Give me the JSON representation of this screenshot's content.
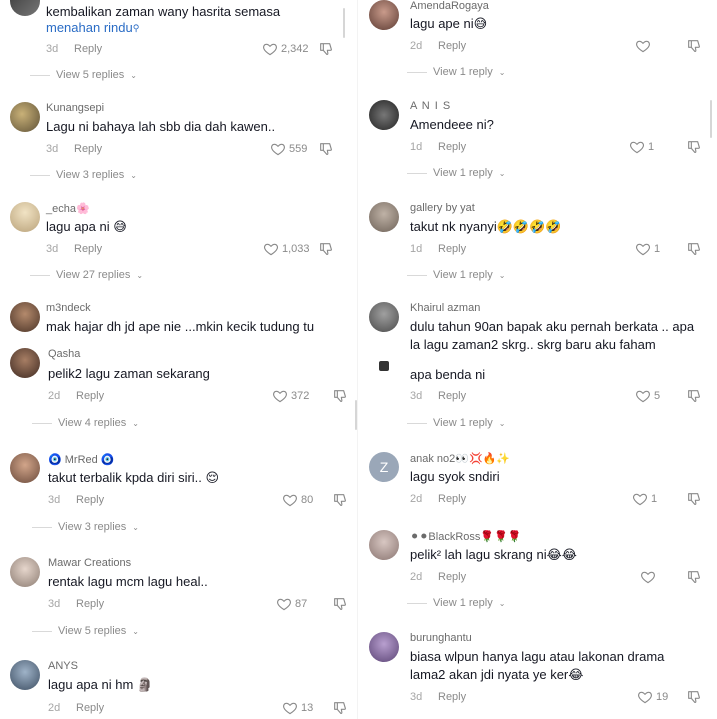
{
  "left": {
    "comments": [
      {
        "username": "",
        "text": "kembalikan zaman wany hasrita semasa",
        "text_extra": "menahan rindu",
        "date": "3d",
        "reply": "Reply",
        "likes": "2,342",
        "view_replies": "View 5 replies"
      },
      {
        "username": "Kunangsepi",
        "text": "Lagu ni bahaya lah sbb dia dah kawen..",
        "date": "3d",
        "reply": "Reply",
        "likes": "559",
        "view_replies": "View 3 replies"
      },
      {
        "username": "_echa🌸",
        "text": "lagu apa ni 😅",
        "date": "3d",
        "reply": "Reply",
        "likes": "1,033",
        "view_replies": "View 27 replies"
      },
      {
        "username": "m3ndeck",
        "text": "mak hajar dh jd ape nie ...mkin kecik tudung tu",
        "date": "",
        "reply": "",
        "likes": "",
        "view_replies": ""
      },
      {
        "username": "Qasha",
        "text": "pelik2 lagu zaman sekarang",
        "date": "2d",
        "reply": "Reply",
        "likes": "372",
        "view_replies": "View 4 replies"
      },
      {
        "username": "🧿 MrRed 🧿",
        "text": "takut terbalik kpda diri siri.. 😌",
        "date": "3d",
        "reply": "Reply",
        "likes": "80",
        "view_replies": "View 3 replies"
      },
      {
        "username": "Mawar Creations",
        "text": "rentak lagu mcm lagu heal..",
        "date": "3d",
        "reply": "Reply",
        "likes": "87",
        "view_replies": "View 5 replies"
      },
      {
        "username": "ANYS",
        "text": "lagu apa ni hm 🗿",
        "date": "2d",
        "reply": "Reply",
        "likes": "13",
        "view_replies": ""
      }
    ]
  },
  "right": {
    "comments": [
      {
        "username": "AmendaRogaya",
        "text": "lagu ape ni😅",
        "date": "2d",
        "reply": "Reply",
        "likes": "",
        "view_replies": "View 1 reply"
      },
      {
        "username": "A N I S",
        "text": "Amendeee ni?",
        "date": "1d",
        "reply": "Reply",
        "likes": "1",
        "view_replies": "View 1 reply"
      },
      {
        "username": "gallery by yat",
        "text": "takut nk nyanyi🤣🤣🤣🤣",
        "date": "1d",
        "reply": "Reply",
        "likes": "1",
        "view_replies": "View 1 reply"
      },
      {
        "username": "Khairul azman",
        "text": "dulu tahun 90an bapak aku pernah berkata .. apa",
        "text2": "la lagu zaman2 skrg.. skrg baru aku faham",
        "date": "",
        "reply": "",
        "likes": "",
        "view_replies": ""
      },
      {
        "username": "",
        "text": "apa benda ni",
        "date": "3d",
        "reply": "Reply",
        "likes": "5",
        "view_replies": "View 1 reply"
      },
      {
        "username": "anak no2👀💢🔥✨",
        "text": "lagu syok sndiri",
        "date": "2d",
        "reply": "Reply",
        "likes": "1",
        "view_replies": "",
        "avatar_letter": "Z"
      },
      {
        "username": "⚫⚫BlackRoss🌹🌹🌹",
        "text": "pelik² lah lagu skrang ni😂😂",
        "date": "2d",
        "reply": "Reply",
        "likes": "",
        "view_replies": "View 1 reply"
      },
      {
        "username": "burunghantu",
        "text": "biasa wlpun hanya lagu atau lakonan drama",
        "text2": "lama2 akan jdi nyata ye ker😂",
        "date": "3d",
        "reply": "Reply",
        "likes": "19",
        "view_replies": ""
      }
    ]
  },
  "colors": {
    "link": "#2a6cc5",
    "muted": "#8a8a8a",
    "text": "#161823"
  },
  "icons": {
    "like": "heart-outline-icon",
    "dislike": "thumbs-down-outline-icon",
    "search": "search-icon"
  }
}
